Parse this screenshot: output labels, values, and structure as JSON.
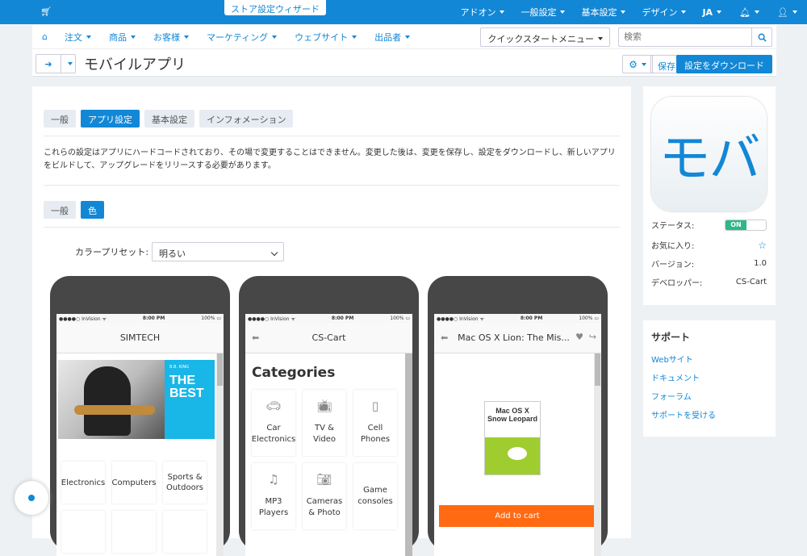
{
  "topbar": {
    "wizard": "ストア設定ウィザード",
    "items": [
      "アドオン",
      "一般設定",
      "基本設定",
      "デザイン",
      "JA"
    ],
    "icons": [
      "cart-icon",
      "bell-icon",
      "user-icon"
    ]
  },
  "menu": {
    "items": [
      "注文",
      "商品",
      "お客様",
      "マーケティング",
      "ウェブサイト",
      "出品者"
    ],
    "quickstart": "クイックスタートメニュー",
    "search_placeholder": "検索"
  },
  "page": {
    "title": "モバイルアプリ",
    "save": "保存",
    "download": "設定をダウンロード"
  },
  "tabs": [
    "一般",
    "アプリ設定",
    "基本設定",
    "インフォメーション"
  ],
  "note": "これらの設定はアプリにハードコードされており、その場で変更することはできません。変更した後は、変更を保存し、設定をダウンロードし、新しいアプリをビルドして、アップグレードをリリースする必要があります。",
  "subtabs": [
    "一般",
    "色"
  ],
  "preset": {
    "label": "カラープリセット:",
    "value": "明るい"
  },
  "phones": [
    {
      "carrier": "●●●●○ InVision ᯤ",
      "time": "8:00 PM",
      "battery": "100%",
      "title": "SIMTECH",
      "banner_small": "B.B. KING",
      "banner_big": "THE BEST",
      "cells": [
        "Electronics",
        "Computers",
        "Sports & Outdoors"
      ]
    },
    {
      "carrier": "●●●●○ InVision ᯤ",
      "time": "8:00 PM",
      "battery": "100%",
      "title": "CS-Cart",
      "heading": "Categories",
      "cells": [
        "Car Electronics",
        "TV & Video",
        "Cell Phones",
        "MP3 Players",
        "Cameras & Photo",
        "Game consoles"
      ]
    },
    {
      "carrier": "●●●●○ InVision ᯤ",
      "time": "8:00 PM",
      "battery": "100%",
      "title": "Mac OS X Lion: The Mis...",
      "book": "Mac OS X Snow Leopard",
      "add": "Add to cart"
    }
  ],
  "app": {
    "icon_text": "モバ",
    "status_label": "ステータス:",
    "status": "ON",
    "fav_label": "お気に入り:",
    "version_label": "バージョン:",
    "version": "1.0",
    "dev_label": "デベロッパー:",
    "developer": "CS-Cart"
  },
  "support": {
    "title": "サポート",
    "links": [
      "Webサイト",
      "ドキュメント",
      "フォーラム",
      "サポートを受ける"
    ]
  },
  "colors": {
    "accent": "#1287d6",
    "button_orange": "#ff6a13",
    "status_green": "#2db886"
  }
}
